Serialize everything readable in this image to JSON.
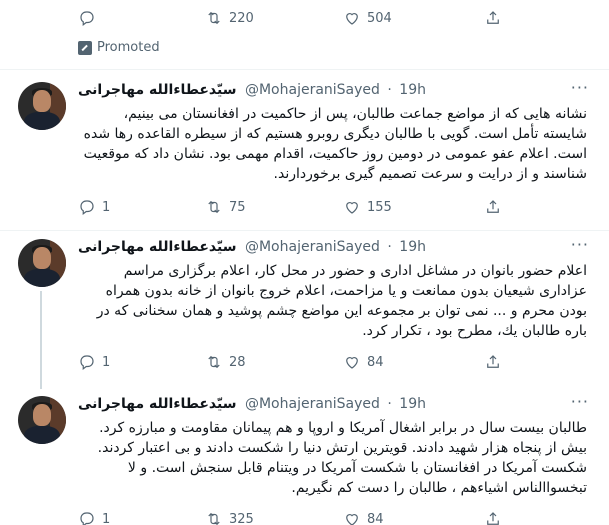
{
  "top_tweet": {
    "reply_count": "",
    "retweet_count": "220",
    "like_count": "504",
    "promoted_label": "Promoted"
  },
  "tweets": [
    {
      "display_name": "سیّدعطاءالله مهاجرانی",
      "handle": "@MohajeraniSayed",
      "time": "19h",
      "text": "نشانه هایی که از مواضع جماعت طالبان، پس از  حاکمیت در افغانستان می بینیم، شایسته تأمل است. گویی با طالبان دیگری روبرو هستیم که از سیطره القاعده رها شده است. اعلام عفو عمومی در دومین روز حاکمیت، اقدام مهمی بود. نشان داد که موقعیت شناسند و از درایت و سرعت تصمیم گیری برخوردارند.",
      "reply_count": "1",
      "retweet_count": "75",
      "like_count": "155"
    },
    {
      "display_name": "سیّدعطاءالله مهاجرانی",
      "handle": "@MohajeraniSayed",
      "time": "19h",
      "text": "اعلام حضور  بانوان در مشاغل اداری و حضور در محل کار، اعلام برگزاری مراسم عزاداری شیعیان بدون ممانعت و یا مزاحمت، اعلام خروج بانوان از خانه بدون همراه بودن محرم و ... نمی توان بر مجموعه این مواضع چشم پوشید و همان سخنانی که در باره طالبان یك، مطرح بود ، تکرار کرد.",
      "reply_count": "1",
      "retweet_count": "28",
      "like_count": "84"
    },
    {
      "display_name": "سیّدعطاءالله مهاجرانی",
      "handle": "@MohajeraniSayed",
      "time": "19h",
      "text": "طالبان بیست سال در برابر اشغال آمریکا و اروپا و هم پیمانان مقاومت و مبارزه کرد. بیش از پنجاه هزار شهید دادند. قویترین ارتش دنیا را شکست دادند و بی اعتبار کردند. شکست آمریکا در افغانستان با شکست آمریکا در ویتنام قابل سنجش است. و لا تبخسوا‌الناس اشیاءهم ، طالبان را دست کم نگیریم.",
      "reply_count": "1",
      "retweet_count": "325",
      "like_count": "84"
    }
  ],
  "icons": [
    "reply-icon",
    "retweet-icon",
    "like-icon",
    "share-icon",
    "more-icon",
    "promoted-icon"
  ]
}
